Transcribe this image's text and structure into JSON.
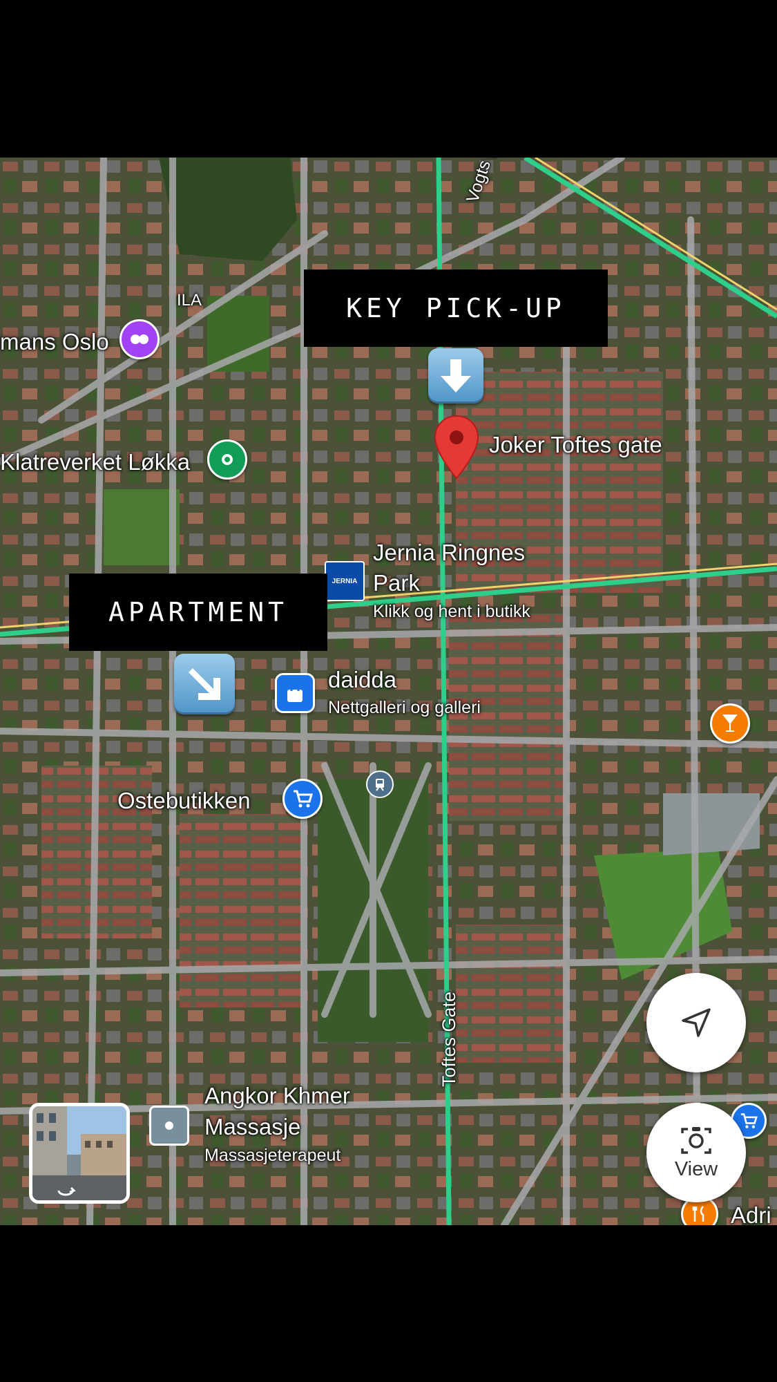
{
  "map": {
    "streets": [
      "Toftes Gate",
      "Vogts gate"
    ],
    "places": {
      "ila": "ILA",
      "mans_oslo": "mans Oslo",
      "klatreverket": "Klatreverket Løkka",
      "joker": "Joker Toftes gate",
      "jernia_line1": "Jernia Ringnes",
      "jernia_line2": "Park",
      "jernia_sub": "Klikk og hent i butikk",
      "jernia_logo": "JERNIA",
      "daidda": "daidda",
      "daidda_sub": "Nettgalleri og galleri",
      "ostebutikken": "Ostebutikken",
      "angkor_line1": "Angkor Khmer",
      "angkor_line2": "Massasje",
      "angkor_sub": "Massasjeterapeut",
      "adri": "Adri"
    },
    "annotations": {
      "key_pickup": "KEY PICK-UP",
      "apartment": "APARTMENT"
    },
    "controls": {
      "view_label": "View"
    },
    "icons": {
      "key_arrow": "down-arrow-icon",
      "apartment_arrow": "down-right-arrow-icon",
      "joker_pin": "red-map-pin-icon",
      "recenter": "navigation-arrow-icon",
      "lens": "camera-search-icon",
      "street_view": "street-view-thumbnail"
    },
    "colors": {
      "transit_line": "#2ecf8a",
      "red_pin": "#e53935",
      "blue_poi": "#1a73e8",
      "purple_poi": "#a142f4",
      "green_poi": "#0f9d58",
      "orange_poi": "#f57c00"
    }
  }
}
